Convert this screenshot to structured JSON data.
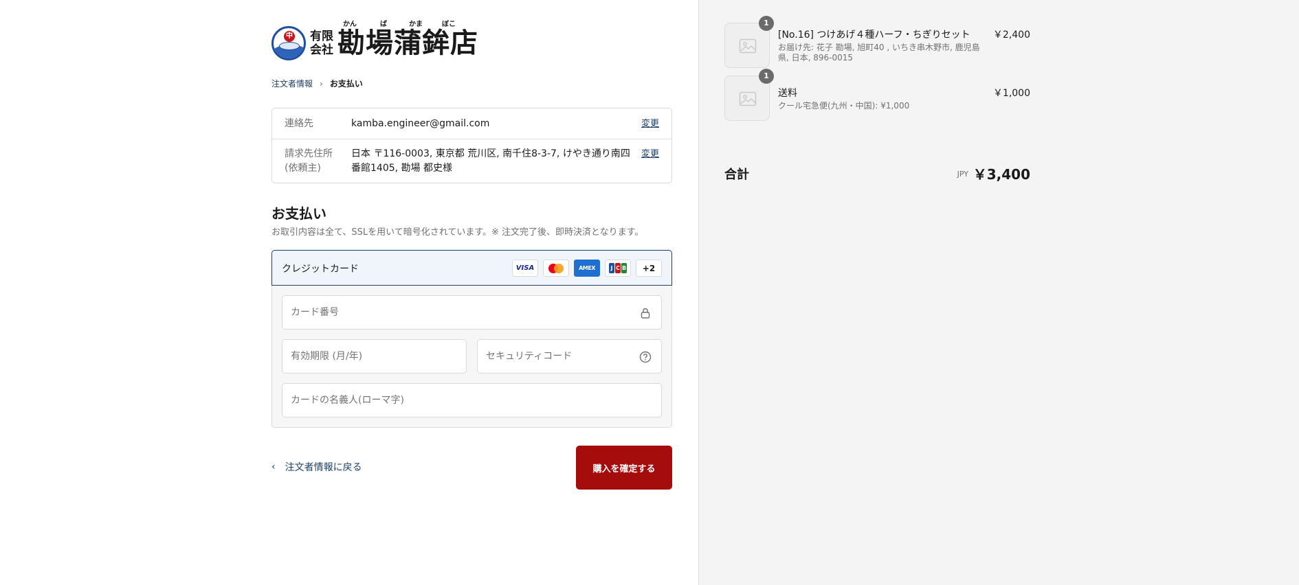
{
  "logo": {
    "small_line1": "有限",
    "small_line2": "会社",
    "big_text": "勘場蒲鉾店",
    "ruby": [
      "かん",
      "ば",
      "かま",
      "ぼこ"
    ],
    "mark_glyph": "中"
  },
  "breadcrumb": {
    "step1": "注文者情報",
    "separator": "›",
    "step2": "お支払い"
  },
  "review": {
    "contact_label": "連絡先",
    "contact_value": "kamba.engineer@gmail.com",
    "billing_label": "請求先住所\n(依頼主)",
    "billing_value": "日本 〒116-0003, 東京都 荒川区, 南千住8-3-7, けやき通り南四番館1405, 勘場 都史様",
    "change_label": "変更"
  },
  "payment": {
    "title": "お支払い",
    "subtitle": "お取引内容は全て、SSLを用いて暗号化されています。※ 注文完了後、即時決済となります。",
    "method_label": "クレジットカード",
    "card_logos": [
      "VISA",
      "mastercard",
      "AMEX",
      "JCB",
      "+2"
    ],
    "card_logo_more": "+2",
    "visa_text": "VISA",
    "amex_text": "AMEX",
    "card_number_placeholder": "カード番号",
    "expiry_placeholder": "有効期限 (月/年)",
    "cvc_placeholder": "セキュリティコード",
    "name_placeholder": "カードの名義人(ローマ字)",
    "icons": {
      "card_number": "lock-icon",
      "cvc": "question-circle-icon"
    }
  },
  "actions": {
    "back_label": "注文者情報に戻る",
    "confirm_label": "購入を確定する"
  },
  "summary": {
    "items": [
      {
        "qty": "1",
        "name": "[No.16] つけあげ４種ハーフ・ちぎりセット",
        "sub": "お届け先: 花子 勘場, 旭町40 , いちき串木野市, 鹿児島県, 日本, 896-0015",
        "price": "￥2,400"
      },
      {
        "qty": "1",
        "name": "送料",
        "sub": "クール宅急便(九州・中国): ¥1,000",
        "price": "￥1,000"
      }
    ],
    "total_label": "合計",
    "currency": "JPY",
    "total_amount": "￥3,400"
  },
  "colors": {
    "accent": "#1f3f66",
    "confirm_button": "#a50d0d",
    "sidebar_bg": "#f4f4f4",
    "selected_method_bg": "#f0f5fc"
  }
}
